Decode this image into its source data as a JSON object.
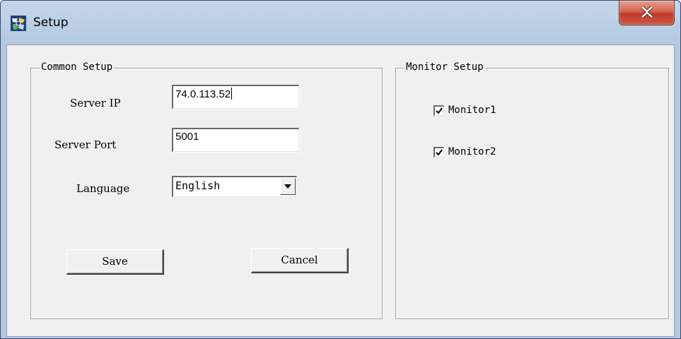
{
  "window": {
    "title": "Setup",
    "close_icon": "close-icon",
    "app_icon": "setup-app-icon"
  },
  "common_setup": {
    "legend": "Common Setup",
    "server_ip_label": "Server IP",
    "server_ip_value": "74.0.113.52",
    "server_port_label": "Server Port",
    "server_port_value": "5001",
    "language_label": "Language",
    "language_value": "English",
    "save_label": "Save",
    "cancel_label": "Cancel"
  },
  "monitor_setup": {
    "legend": "Monitor Setup",
    "monitors": [
      {
        "label": "Monitor1",
        "checked": true
      },
      {
        "label": "Monitor2",
        "checked": true
      }
    ]
  },
  "colors": {
    "close_button": "#c1392b",
    "titlebar": "#b9cde4",
    "dialog_face": "#f0f0f0"
  }
}
